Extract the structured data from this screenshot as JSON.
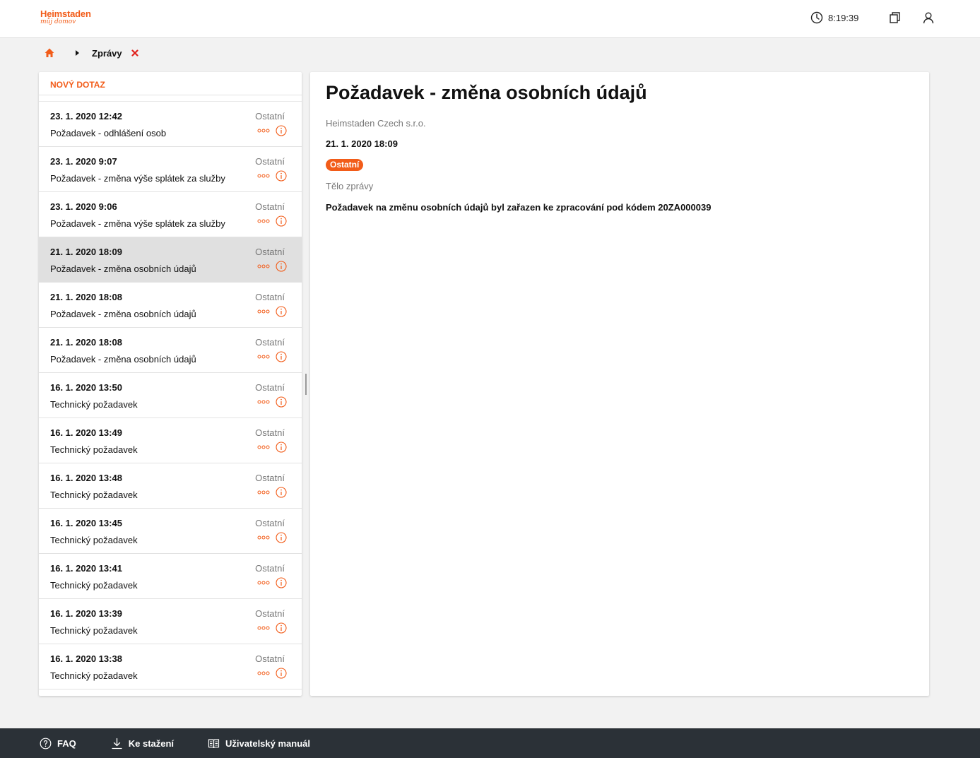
{
  "header": {
    "logo_name": "Heimstaden",
    "logo_tagline": "můj domov",
    "time": "8:19:39"
  },
  "breadcrumb": {
    "current": "Zprávy"
  },
  "list": {
    "new_query_label": "NOVÝ DOTAZ",
    "items": [
      {
        "date": "23. 1. 2020 12:42",
        "subject": "Požadavek - odhlášení osob",
        "category": "Ostatní"
      },
      {
        "date": "23. 1. 2020 9:07",
        "subject": "Požadavek - změna výše splátek za služby",
        "category": "Ostatní"
      },
      {
        "date": "23. 1. 2020 9:06",
        "subject": "Požadavek - změna výše splátek za služby",
        "category": "Ostatní"
      },
      {
        "date": "21. 1. 2020 18:09",
        "subject": "Požadavek - změna osobních údajů",
        "category": "Ostatní"
      },
      {
        "date": "21. 1. 2020 18:08",
        "subject": "Požadavek - změna osobních údajů",
        "category": "Ostatní"
      },
      {
        "date": "21. 1. 2020 18:08",
        "subject": "Požadavek - změna osobních údajů",
        "category": "Ostatní"
      },
      {
        "date": "16. 1. 2020 13:50",
        "subject": "Technický požadavek",
        "category": "Ostatní"
      },
      {
        "date": "16. 1. 2020 13:49",
        "subject": "Technický požadavek",
        "category": "Ostatní"
      },
      {
        "date": "16. 1. 2020 13:48",
        "subject": "Technický požadavek",
        "category": "Ostatní"
      },
      {
        "date": "16. 1. 2020 13:45",
        "subject": "Technický požadavek",
        "category": "Ostatní"
      },
      {
        "date": "16. 1. 2020 13:41",
        "subject": "Technický požadavek",
        "category": "Ostatní"
      },
      {
        "date": "16. 1. 2020 13:39",
        "subject": "Technický požadavek",
        "category": "Ostatní"
      },
      {
        "date": "16. 1. 2020 13:38",
        "subject": "Technický požadavek",
        "category": "Ostatní"
      }
    ]
  },
  "detail": {
    "title": "Požadavek - změna osobních údajů",
    "sender": "Heimstaden Czech s.r.o.",
    "date": "21. 1. 2020 18:09",
    "category": "Ostatní",
    "body_label": "Tělo zprávy",
    "body": "Požadavek na změnu osobních údajů byl zařazen ke zpracování pod kódem 20ZA000039"
  },
  "footer": {
    "faq": "FAQ",
    "downloads": "Ke stažení",
    "manual": "Uživatelský manuál"
  },
  "colors": {
    "accent": "#f25c19",
    "footer_bg": "#2b3137",
    "selected_row": "#e0e0e0"
  },
  "icons": [
    "clock-icon",
    "copy-icon",
    "user-icon",
    "home-icon",
    "chevron-right-icon",
    "close-icon",
    "more-icon",
    "info-icon",
    "help-icon",
    "download-icon",
    "book-icon"
  ]
}
